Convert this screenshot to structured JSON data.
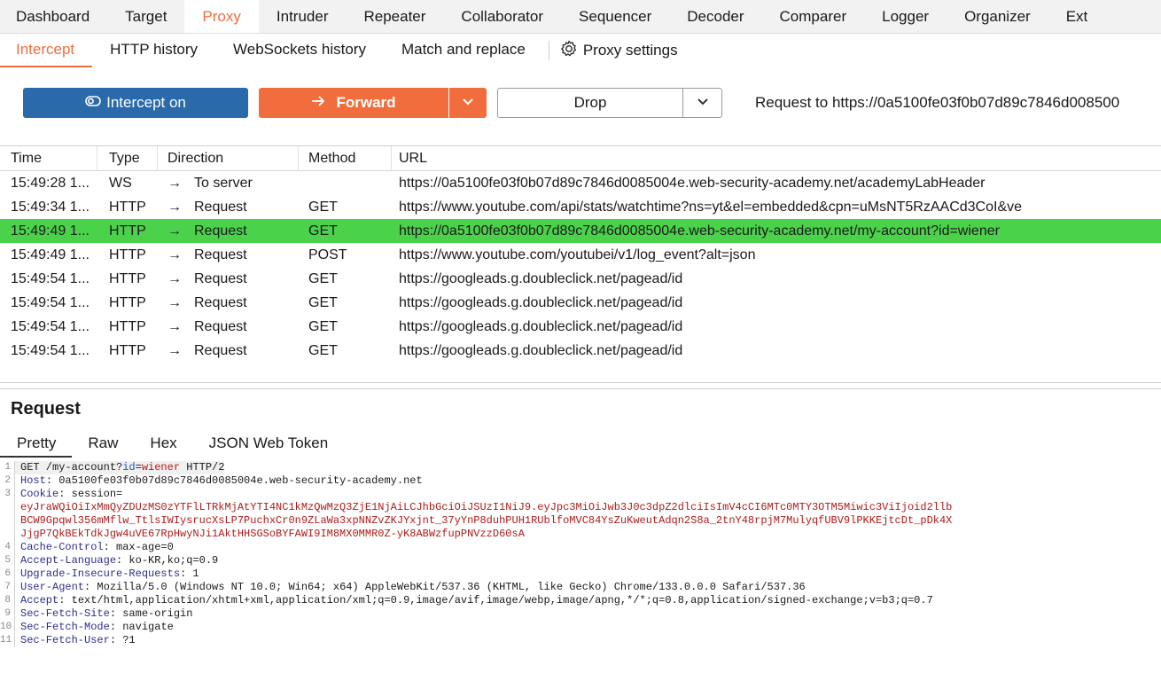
{
  "top_tabs": [
    "Dashboard",
    "Target",
    "Proxy",
    "Intruder",
    "Repeater",
    "Collaborator",
    "Sequencer",
    "Decoder",
    "Comparer",
    "Logger",
    "Organizer",
    "Ext"
  ],
  "active_top_tab": "Proxy",
  "sub_tabs": [
    "Intercept",
    "HTTP history",
    "WebSockets history",
    "Match and replace"
  ],
  "proxy_settings_label": "Proxy settings",
  "toolbar": {
    "intercept_label": "Intercept on",
    "forward_label": "Forward",
    "drop_label": "Drop",
    "request_to": "Request to https://0a5100fe03f0b07d89c7846d008500"
  },
  "table": {
    "headers": [
      "Time",
      "Type",
      "Direction",
      "Method",
      "URL"
    ],
    "rows": [
      {
        "time": "15:49:28 1...",
        "type": "WS",
        "direction": "To server",
        "method": "",
        "url": "https://0a5100fe03f0b07d89c7846d0085004e.web-security-academy.net/academyLabHeader"
      },
      {
        "time": "15:49:34 1...",
        "type": "HTTP",
        "direction": "Request",
        "method": "GET",
        "url": "https://www.youtube.com/api/stats/watchtime?ns=yt&el=embedded&cpn=uMsNT5RzAACd3CoI&ve"
      },
      {
        "time": "15:49:49 1...",
        "type": "HTTP",
        "direction": "Request",
        "method": "GET",
        "url": "https://0a5100fe03f0b07d89c7846d0085004e.web-security-academy.net/my-account?id=wiener"
      },
      {
        "time": "15:49:49 1...",
        "type": "HTTP",
        "direction": "Request",
        "method": "POST",
        "url": "https://www.youtube.com/youtubei/v1/log_event?alt=json"
      },
      {
        "time": "15:49:54 1...",
        "type": "HTTP",
        "direction": "Request",
        "method": "GET",
        "url": "https://googleads.g.doubleclick.net/pagead/id"
      },
      {
        "time": "15:49:54 1...",
        "type": "HTTP",
        "direction": "Request",
        "method": "GET",
        "url": "https://googleads.g.doubleclick.net/pagead/id"
      },
      {
        "time": "15:49:54 1...",
        "type": "HTTP",
        "direction": "Request",
        "method": "GET",
        "url": "https://googleads.g.doubleclick.net/pagead/id"
      },
      {
        "time": "15:49:54 1...",
        "type": "HTTP",
        "direction": "Request",
        "method": "GET",
        "url": "https://googleads.g.doubleclick.net/pagead/id"
      }
    ],
    "selected_row": 2
  },
  "request_panel": {
    "title": "Request",
    "tabs": [
      "Pretty",
      "Raw",
      "Hex",
      "JSON Web Token"
    ],
    "active_tab": "Pretty"
  },
  "request_lines": [
    {
      "n": "1",
      "parts": [
        {
          "t": "GET /my-account?",
          "c": "hv"
        },
        {
          "t": "id",
          "c": "blue"
        },
        {
          "t": "=",
          "c": "hv"
        },
        {
          "t": "wiener",
          "c": "red"
        },
        {
          "t": " HTTP/2",
          "c": "hv"
        }
      ]
    },
    {
      "n": "2",
      "parts": [
        {
          "t": "Host",
          "c": "hk"
        },
        {
          "t": ": 0a5100fe03f0b07d89c7846d0085004e.web-security-academy.net",
          "c": "hv"
        }
      ]
    },
    {
      "n": "3",
      "parts": [
        {
          "t": "Cookie",
          "c": "hk"
        },
        {
          "t": ": session=",
          "c": "hv"
        }
      ]
    },
    {
      "n": "",
      "parts": [
        {
          "t": "eyJraWQiOiIxMmQyZDUzMS0zYTFlLTRkMjAtYTI4NC1kMzQwMzQ3ZjE1NjAiLCJhbGciOiJSUzI1NiJ9.eyJpc3MiOiJwb3J0c3dpZ2dlciIsImV4cCI6MTc0MTY3OTM5Miwic3ViIjoid2llb",
          "c": "red"
        }
      ]
    },
    {
      "n": "",
      "parts": [
        {
          "t": "BCW9Gpqwl356mMflw_TtlsIWIysrucXsLP7PuchxCr0n9ZLaWa3xpNNZvZKJYxjnt_37yYnP8duhPUH1RUblfoMVC84YsZuKweutAdqn2S8a_2tnY48rpjM7MulyqfUBV9lPKKEjtcDt_pDk4X",
          "c": "red"
        }
      ]
    },
    {
      "n": "",
      "parts": [
        {
          "t": "JjgP7QkBEkTdkJgw4uVE67RpHwyNJi1AktHHSGSoBYFAWI9IM8MX0MMR0Z-yK8ABWzfupPNVzzD60sA",
          "c": "red"
        }
      ]
    },
    {
      "n": "4",
      "parts": [
        {
          "t": "Cache-Control",
          "c": "hk"
        },
        {
          "t": ": max-age=0",
          "c": "hv"
        }
      ]
    },
    {
      "n": "5",
      "parts": [
        {
          "t": "Accept-Language",
          "c": "hk"
        },
        {
          "t": ": ko-KR,ko;q=0.9",
          "c": "hv"
        }
      ]
    },
    {
      "n": "6",
      "parts": [
        {
          "t": "Upgrade-Insecure-Requests",
          "c": "hk"
        },
        {
          "t": ": 1",
          "c": "hv"
        }
      ]
    },
    {
      "n": "7",
      "parts": [
        {
          "t": "User-Agent",
          "c": "hk"
        },
        {
          "t": ": Mozilla/5.0 (Windows NT 10.0; Win64; x64) AppleWebKit/537.36 (KHTML, like Gecko) Chrome/133.0.0.0 Safari/537.36",
          "c": "hv"
        }
      ]
    },
    {
      "n": "8",
      "parts": [
        {
          "t": "Accept",
          "c": "hk"
        },
        {
          "t": ": text/html,application/xhtml+xml,application/xml;q=0.9,image/avif,image/webp,image/apng,*/*;q=0.8,application/signed-exchange;v=b3;q=0.7",
          "c": "hv"
        }
      ]
    },
    {
      "n": "9",
      "parts": [
        {
          "t": "Sec-Fetch-Site",
          "c": "hk"
        },
        {
          "t": ": same-origin",
          "c": "hv"
        }
      ]
    },
    {
      "n": "10",
      "parts": [
        {
          "t": "Sec-Fetch-Mode",
          "c": "hk"
        },
        {
          "t": ": navigate",
          "c": "hv"
        }
      ]
    },
    {
      "n": "11",
      "parts": [
        {
          "t": "Sec-Fetch-User",
          "c": "hk"
        },
        {
          "t": ": ?1",
          "c": "hv"
        }
      ]
    }
  ],
  "colors": {
    "accent": "#f26d3d",
    "intercept_blue": "#2a6aab",
    "selected_row": "#4bd24b"
  },
  "icons": {
    "intercept": "toggle-eye-icon",
    "forward": "arrow-right-icon",
    "dropdown": "chevron-down-icon",
    "settings": "gear-icon",
    "direction": "arrow-right-icon"
  }
}
